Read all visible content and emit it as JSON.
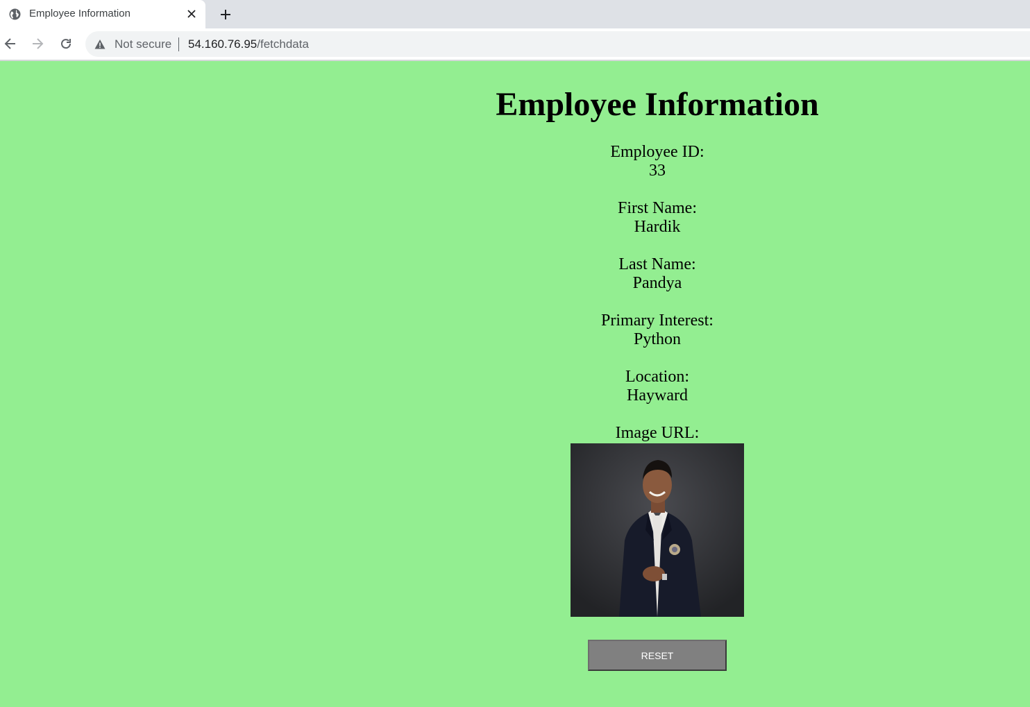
{
  "browser": {
    "tab_title": "Employee Information",
    "not_secure_label": "Not secure",
    "url_host": "54.160.76.95",
    "url_path": "/fetchdata"
  },
  "page": {
    "title": "Employee Information",
    "background_color": "#93ee91",
    "fields": [
      {
        "label": "Employee ID:",
        "value": "33"
      },
      {
        "label": "First Name:",
        "value": "Hardik"
      },
      {
        "label": "Last Name:",
        "value": "Pandya"
      },
      {
        "label": "Primary Interest:",
        "value": "Python"
      },
      {
        "label": "Location:",
        "value": "Hayward"
      }
    ],
    "image_label": "Image URL:",
    "reset_label": "RESET"
  }
}
